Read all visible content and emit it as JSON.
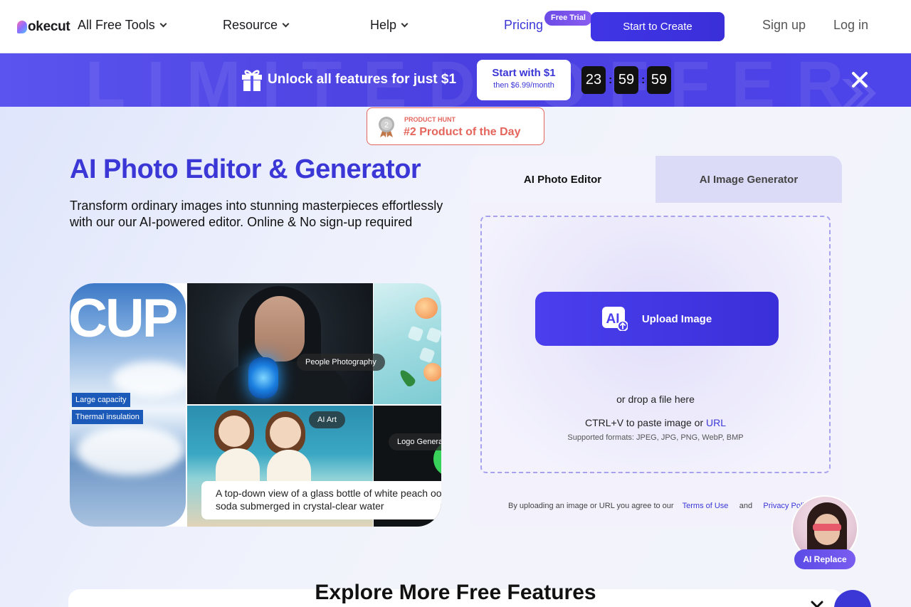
{
  "header": {
    "logo_text": "okecut",
    "nav": [
      {
        "label": "All Free Tools"
      },
      {
        "label": "Resource"
      },
      {
        "label": "Help"
      }
    ],
    "pricing_label": "Pricing",
    "free_trial_badge": "Free Trial",
    "start_button": "Start to Create",
    "signup": "Sign up",
    "login": "Log in"
  },
  "banner": {
    "watermark": "LIMITED OFFER",
    "text": "Unlock all features for just $1",
    "cta_title": "Start with $1",
    "cta_sub": "then $6.99/month",
    "countdown": {
      "hours": "23",
      "minutes": "59",
      "seconds": "59"
    }
  },
  "product_hunt": {
    "rank": "2",
    "small": "PRODUCT HUNT",
    "big": "#2 Product of the Day"
  },
  "hero": {
    "title": "AI Photo Editor & Generator",
    "subtitle": "Transform ordinary images into stunning masterpieces effortlessly with our our AI-powered editor. Online & No sign-up required"
  },
  "collage": {
    "cup_text": "CUP",
    "tags": [
      "Large capacity",
      "Thermal insulation"
    ],
    "pills": [
      "People Photography",
      "AI Art",
      "Logo Genera"
    ],
    "prompt": "A top-down view of a glass bottle of white peach oo soda submerged in crystal-clear water"
  },
  "panel": {
    "tabs": [
      {
        "label": "AI Photo Editor",
        "active": true
      },
      {
        "label": "AI Image Generator",
        "active": false
      }
    ],
    "upload_button": "Upload Image",
    "drop_text": "or drop a file here",
    "paste_text": "CTRL+V to paste image or",
    "url_link": "URL",
    "formats": "Supported formats: JPEG, JPG, PNG, WebP, BMP",
    "terms_prefix": "By uploading an image or URL you agree to our",
    "terms_link": "Terms of Use",
    "terms_and": "and",
    "privacy_link": "Privacy Policy"
  },
  "ai_replace": {
    "label": "AI Replace"
  },
  "explore": {
    "title": "Explore More Free Features"
  },
  "colors": {
    "brand": "#3b37d6",
    "banner": "#4a3fe0",
    "product_hunt": "#e4655c",
    "free_trial": "#7a54ea"
  },
  "icons": [
    "chevron-down-icon",
    "gift-icon",
    "close-icon",
    "medal-icon",
    "ai-upload-icon",
    "chat-icon"
  ]
}
